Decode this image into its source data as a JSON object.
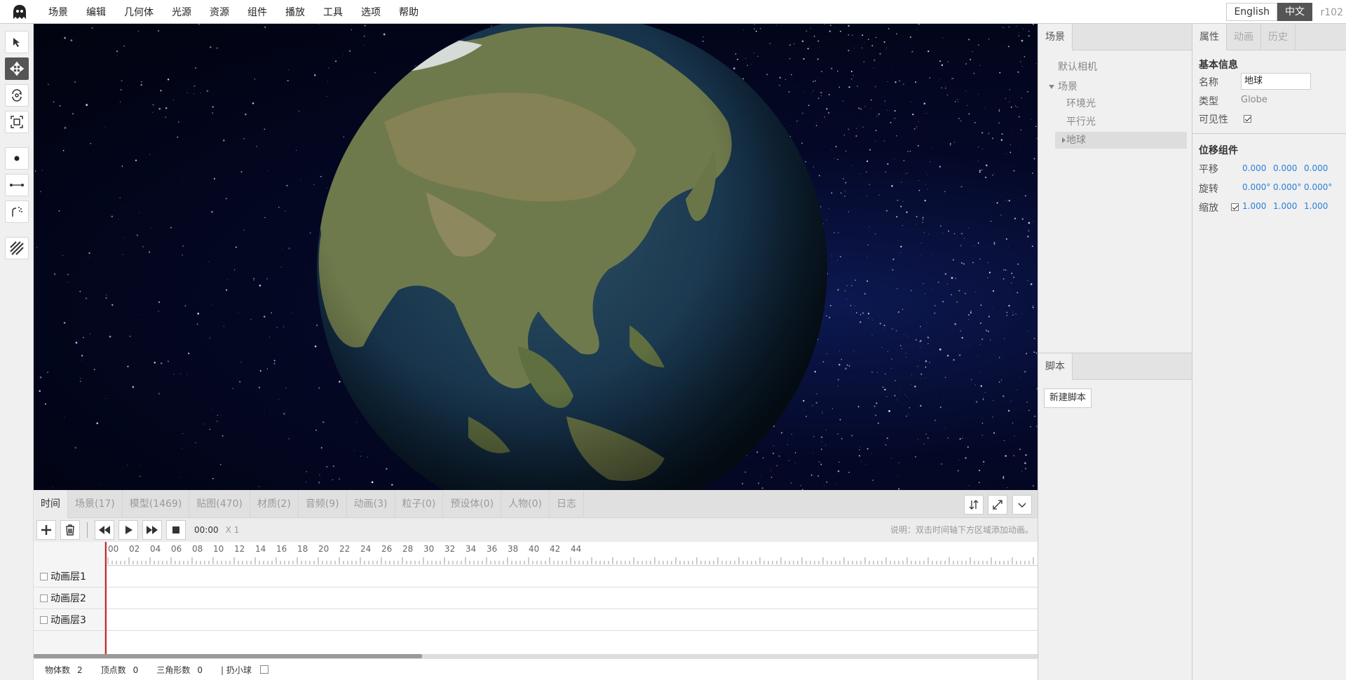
{
  "app": {
    "version": "r102"
  },
  "menu": [
    "场景",
    "编辑",
    "几何体",
    "光源",
    "资源",
    "组件",
    "播放",
    "工具",
    "选项",
    "帮助"
  ],
  "language": {
    "english": "English",
    "chinese": "中文",
    "active": "中文"
  },
  "toolbar_icons": [
    "select-arrow-icon",
    "translate-icon",
    "rotate-icon",
    "scale-icon",
    "point-icon",
    "line-icon",
    "spray-icon",
    "hatch-icon"
  ],
  "timeline": {
    "tabs": [
      "时间",
      "场景(17)",
      "模型(1469)",
      "贴图(470)",
      "材质(2)",
      "音频(9)",
      "动画(3)",
      "粒子(0)",
      "预设体(0)",
      "人物(0)",
      "日志"
    ],
    "active_tab": "时间",
    "time": "00:00",
    "speed": "X 1",
    "hint": "说明：双击时间轴下方区域添加动画。",
    "ruler_labels": [
      "00",
      "02",
      "04",
      "06",
      "08",
      "10",
      "12",
      "14",
      "16",
      "18",
      "20",
      "22",
      "24",
      "26",
      "28",
      "30",
      "32",
      "34",
      "36",
      "38",
      "40",
      "42",
      "44"
    ],
    "layers": [
      "动画层1",
      "动画层2",
      "动画层3"
    ]
  },
  "status": {
    "objects_label": "物体数",
    "objects": "2",
    "vertices_label": "顶点数",
    "vertices": "0",
    "triangles_label": "三角形数",
    "triangles": "0",
    "throw_ball_label": "| 扔小球"
  },
  "scene_panel": {
    "tab": "场景",
    "tree": [
      "默认相机",
      "场景",
      "环境光",
      "平行光",
      "地球"
    ],
    "selected": "地球",
    "script_tab": "脚本",
    "new_script": "新建脚本"
  },
  "properties": {
    "tabs": [
      "属性",
      "动画",
      "历史"
    ],
    "active_tab": "属性",
    "basic_info": "基本信息",
    "name_label": "名称",
    "name_value": "地球",
    "type_label": "类型",
    "type_value": "Globe",
    "visible_label": "可见性",
    "visible": true,
    "transform_title": "位移组件",
    "position_label": "平移",
    "position": [
      "0.000",
      "0.000",
      "0.000"
    ],
    "rotation_label": "旋转",
    "rotation": [
      "0.000°",
      "0.000°",
      "0.000°"
    ],
    "scale_label": "缩放",
    "scale_locked": true,
    "scale": [
      "1.000",
      "1.000",
      "1.000"
    ]
  },
  "colors": {
    "accent": "#2a7fd6",
    "playhead": "#d62020",
    "active_lang": "#555555"
  }
}
